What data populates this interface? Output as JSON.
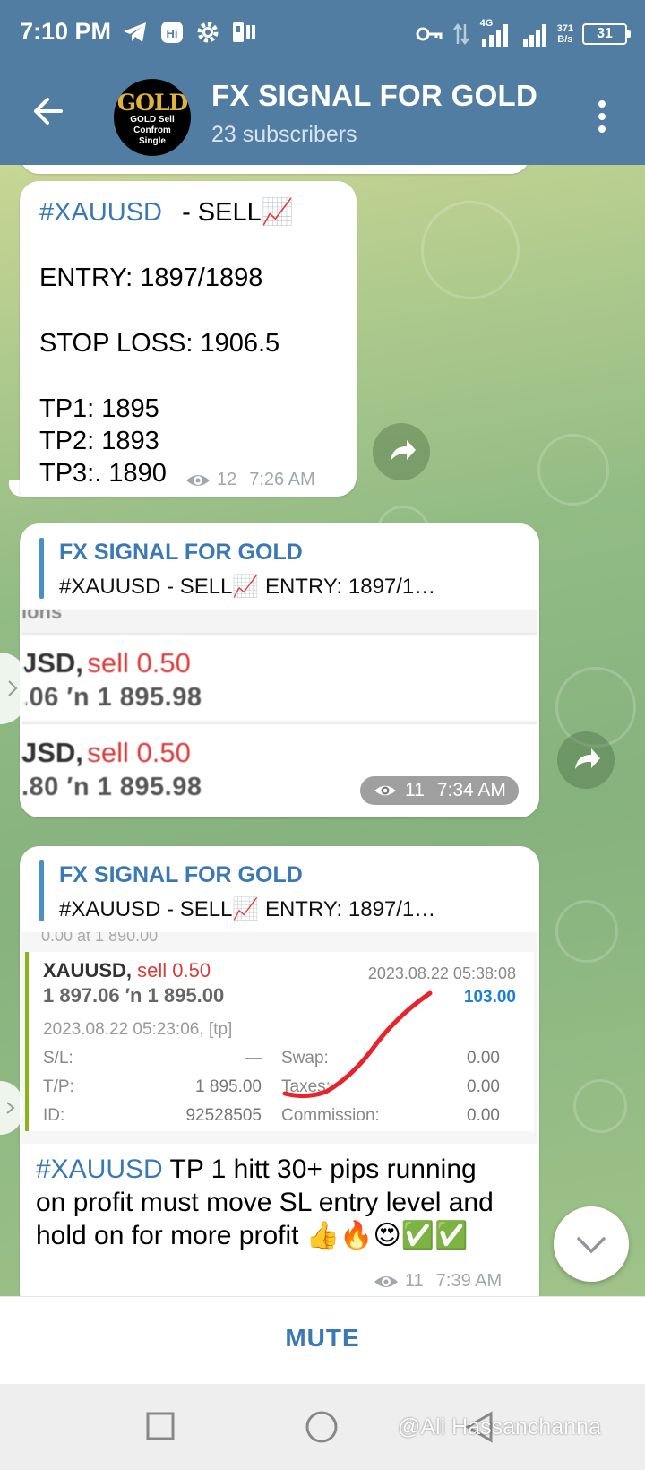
{
  "status_bar": {
    "time": "7:10 PM",
    "network": "4G",
    "speed_value": "371",
    "speed_unit": "B/s",
    "battery": "31"
  },
  "header": {
    "avatar_text": "GOLD",
    "avatar_line1": "GOLD Sell",
    "avatar_line2": "Confrom",
    "avatar_line3": "Single",
    "title": "FX SIGNAL FOR GOLD",
    "subtitle": "23 subscribers"
  },
  "message1": {
    "hashtag": "#XAUUSD",
    "action": "- SELL📈",
    "entry": "ENTRY:  1897/1898",
    "stop_loss": "STOP LOSS: 1906.5",
    "tp1": "TP1:  1895",
    "tp2": "TP2:  1893",
    "tp3": "TP3:. 1890",
    "views": "12",
    "time": "7:26 AM"
  },
  "message2": {
    "reply_name": "FX SIGNAL FOR GOLD",
    "reply_text": "#XAUUSD   - SELL📈      ENTRY:  1897/1…",
    "shot_header": "ions",
    "row1_symbol": "JSD,",
    "row1_side": "sell 0.50",
    "row1_prices": ".06 ′n  1 895.98",
    "row2_symbol": "JSD,",
    "row2_side": "sell 0.50",
    "row2_prices": ".80 ′n  1 895.98",
    "views": "11",
    "time": "7:34 AM"
  },
  "message3": {
    "reply_name": "FX SIGNAL FOR GOLD",
    "reply_text": "#XAUUSD   - SELL📈      ENTRY:  1897/1…",
    "shot_top": "0.00 at 1 890.00",
    "symbol": "XAUUSD,",
    "side": "sell 0.50",
    "close_date": "2023.08.22 05:38:08",
    "prices": "1 897.06 ′n  1 895.00",
    "profit": "103.00",
    "open_date": "2023.08.22 05:23:06, [tp]",
    "sl_label": "S/L:",
    "sl_value": "—",
    "swap_label": "Swap:",
    "swap_value": "0.00",
    "tp_label": "T/P:",
    "tp_value": "1 895.00",
    "taxes_label": "Taxes:",
    "taxes_value": "0.00",
    "id_label": "ID:",
    "id_value": "92528505",
    "commission_label": "Commission:",
    "commission_value": "0.00",
    "hashtag": "#XAUUSD",
    "text": " TP 1  hitt 30+ pips running on profit must move SL entry level and hold on for more profit 👍🔥😍✅✅",
    "views": "11",
    "time": "7:39 AM"
  },
  "bottom": {
    "mute_label": "MUTE"
  },
  "watermark": "@Ali Hassanchanna"
}
